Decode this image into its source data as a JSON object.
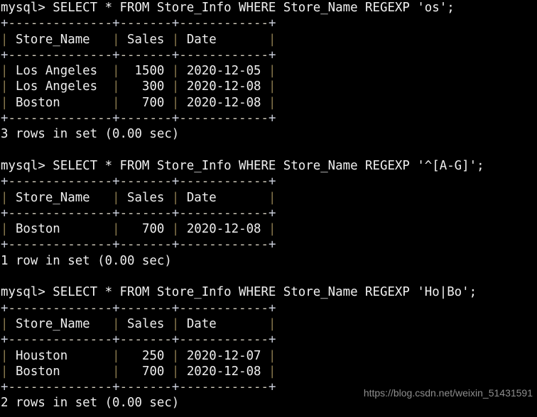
{
  "terminal": {
    "background_color": "#000000",
    "text_color": "#e6e6e6",
    "border_pipe_color": "#8a7a4e",
    "prompt": "mysql> ",
    "blocks": [
      {
        "query": "mysql> SELECT * FROM Store_Info WHERE Store_Name REGEXP 'os';",
        "table": {
          "separator": "+--------------+-------+------------+",
          "header": "| Store_Name   | Sales | Date       |",
          "rows": [
            "| Los Angeles  |  1500 | 2020-12-05 |",
            "| Los Angeles  |   300 | 2020-12-08 |",
            "| Boston       |   700 | 2020-12-08 |"
          ],
          "columns": [
            "Store_Name",
            "Sales",
            "Date"
          ],
          "data": [
            {
              "Store_Name": "Los Angeles",
              "Sales": "1500",
              "Date": "2020-12-05"
            },
            {
              "Store_Name": "Los Angeles",
              "Sales": "300",
              "Date": "2020-12-08"
            },
            {
              "Store_Name": "Boston",
              "Sales": "700",
              "Date": "2020-12-08"
            }
          ]
        },
        "status": "3 rows in set (0.00 sec)"
      },
      {
        "query": "mysql> SELECT * FROM Store_Info WHERE Store_Name REGEXP '^[A-G]';",
        "table": {
          "separator": "+--------------+-------+------------+",
          "header": "| Store_Name   | Sales | Date       |",
          "rows": [
            "| Boston       |   700 | 2020-12-08 |"
          ],
          "columns": [
            "Store_Name",
            "Sales",
            "Date"
          ],
          "data": [
            {
              "Store_Name": "Boston",
              "Sales": "700",
              "Date": "2020-12-08"
            }
          ]
        },
        "status": "1 row in set (0.00 sec)"
      },
      {
        "query": "mysql> SELECT * FROM Store_Info WHERE Store_Name REGEXP 'Ho|Bo';",
        "table": {
          "separator": "+--------------+-------+------------+",
          "header": "| Store_Name   | Sales | Date       |",
          "rows": [
            "| Houston      |   250 | 2020-12-07 |",
            "| Boston       |   700 | 2020-12-08 |"
          ],
          "columns": [
            "Store_Name",
            "Sales",
            "Date"
          ],
          "data": [
            {
              "Store_Name": "Houston",
              "Sales": "250",
              "Date": "2020-12-07"
            },
            {
              "Store_Name": "Boston",
              "Sales": "700",
              "Date": "2020-12-08"
            }
          ]
        },
        "status": "2 rows in set (0.00 sec)"
      }
    ]
  },
  "watermark": {
    "text": "https://blog.csdn.net/weixin_51431591"
  }
}
